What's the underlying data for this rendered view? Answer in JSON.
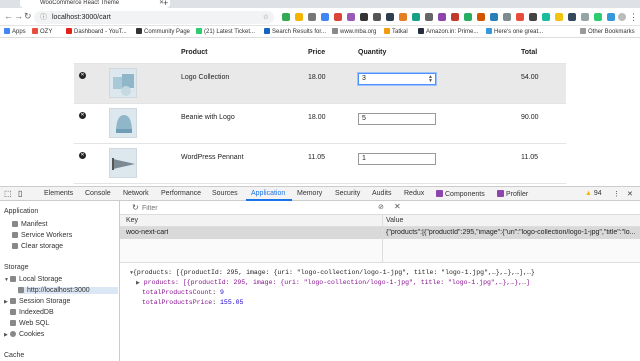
{
  "browser": {
    "tab_title": "WooCommerce React Theme",
    "url": "localhost:3000/cart",
    "bookmarks": [
      {
        "label": "Apps",
        "color": "#4285f4"
      },
      {
        "label": "OZY",
        "color": "#e74c3c"
      },
      {
        "label": "Dashboard - YouT...",
        "color": "#e62117"
      },
      {
        "label": "Community Page",
        "color": "#333333"
      },
      {
        "label": "(21) Latest Ticket...",
        "color": "#2ecc71"
      },
      {
        "label": "Search Results for...",
        "color": "#1565c0"
      },
      {
        "label": "www.mba.org",
        "color": "#888888"
      },
      {
        "label": "Tatkal",
        "color": "#f39c12"
      },
      {
        "label": "Amazon.in: Prime...",
        "color": "#232f3e"
      },
      {
        "label": "Here's one great...",
        "color": "#3498db"
      }
    ],
    "other_bookmarks": "Other Bookmarks"
  },
  "cart": {
    "headers": {
      "product": "Product",
      "price": "Price",
      "quantity": "Quantity",
      "total": "Total"
    },
    "items": [
      {
        "name": "Logo Collection",
        "price": "18.00",
        "quantity": "3",
        "total": "54.00"
      },
      {
        "name": "Beanie with Logo",
        "price": "18.00",
        "quantity": "5",
        "total": "90.00"
      },
      {
        "name": "WordPress Pennant",
        "price": "11.05",
        "quantity": "1",
        "total": "11.05"
      }
    ]
  },
  "devtools": {
    "tabs": [
      "Elements",
      "Console",
      "Network",
      "Performance",
      "Sources",
      "Application",
      "Memory",
      "Security",
      "Audits",
      "Redux",
      "Components",
      "Profiler"
    ],
    "active_tab": "Application",
    "warnings": "94",
    "sidebar": {
      "application_heading": "Application",
      "application_items": [
        "Manifest",
        "Service Workers",
        "Clear storage"
      ],
      "storage_heading": "Storage",
      "local_storage": "Local Storage",
      "local_storage_origin": "http://localhost:3000",
      "storage_items": [
        "Session Storage",
        "IndexedDB",
        "Web SQL",
        "Cookies"
      ],
      "cache_heading": "Cache"
    },
    "filter_placeholder": "Filter",
    "columns": {
      "key": "Key",
      "value": "Value"
    },
    "entry": {
      "key": "woo-next-cart",
      "value": "{\"products\":[{\"productId\":295,\"image\":{\"uri\":\"logo-collection/logo-1-jpg\",\"title\":\"lo..."
    },
    "preview": {
      "line1": "{products: [{productId: 295, image: {uri: \"logo-collection/logo-1-jpg\", title: \"logo-1.jpg\",…},…},…],…}",
      "line2": "products: [{productId: 295, image: {uri: \"logo-collection/logo-1-jpg\", title: \"logo-1.jpg\",…},…},…]",
      "count_key": "totalProductsCount",
      "count_value": "9",
      "price_key": "totalProductsPrice",
      "price_value": "155.05"
    }
  }
}
